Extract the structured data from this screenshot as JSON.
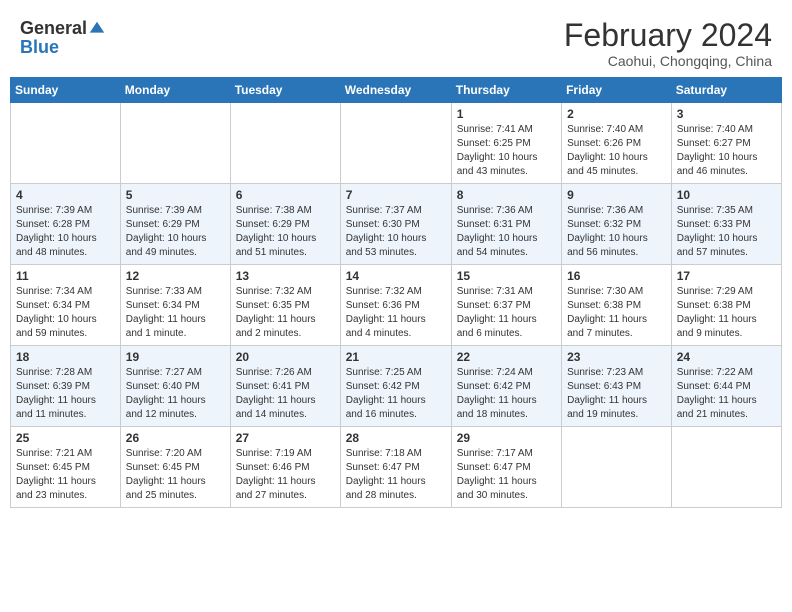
{
  "header": {
    "logo_general": "General",
    "logo_blue": "Blue",
    "month_title": "February 2024",
    "location": "Caohui, Chongqing, China"
  },
  "days_of_week": [
    "Sunday",
    "Monday",
    "Tuesday",
    "Wednesday",
    "Thursday",
    "Friday",
    "Saturday"
  ],
  "weeks": [
    [
      {
        "num": "",
        "info": ""
      },
      {
        "num": "",
        "info": ""
      },
      {
        "num": "",
        "info": ""
      },
      {
        "num": "",
        "info": ""
      },
      {
        "num": "1",
        "info": "Sunrise: 7:41 AM\nSunset: 6:25 PM\nDaylight: 10 hours\nand 43 minutes."
      },
      {
        "num": "2",
        "info": "Sunrise: 7:40 AM\nSunset: 6:26 PM\nDaylight: 10 hours\nand 45 minutes."
      },
      {
        "num": "3",
        "info": "Sunrise: 7:40 AM\nSunset: 6:27 PM\nDaylight: 10 hours\nand 46 minutes."
      }
    ],
    [
      {
        "num": "4",
        "info": "Sunrise: 7:39 AM\nSunset: 6:28 PM\nDaylight: 10 hours\nand 48 minutes."
      },
      {
        "num": "5",
        "info": "Sunrise: 7:39 AM\nSunset: 6:29 PM\nDaylight: 10 hours\nand 49 minutes."
      },
      {
        "num": "6",
        "info": "Sunrise: 7:38 AM\nSunset: 6:29 PM\nDaylight: 10 hours\nand 51 minutes."
      },
      {
        "num": "7",
        "info": "Sunrise: 7:37 AM\nSunset: 6:30 PM\nDaylight: 10 hours\nand 53 minutes."
      },
      {
        "num": "8",
        "info": "Sunrise: 7:36 AM\nSunset: 6:31 PM\nDaylight: 10 hours\nand 54 minutes."
      },
      {
        "num": "9",
        "info": "Sunrise: 7:36 AM\nSunset: 6:32 PM\nDaylight: 10 hours\nand 56 minutes."
      },
      {
        "num": "10",
        "info": "Sunrise: 7:35 AM\nSunset: 6:33 PM\nDaylight: 10 hours\nand 57 minutes."
      }
    ],
    [
      {
        "num": "11",
        "info": "Sunrise: 7:34 AM\nSunset: 6:34 PM\nDaylight: 10 hours\nand 59 minutes."
      },
      {
        "num": "12",
        "info": "Sunrise: 7:33 AM\nSunset: 6:34 PM\nDaylight: 11 hours\nand 1 minute."
      },
      {
        "num": "13",
        "info": "Sunrise: 7:32 AM\nSunset: 6:35 PM\nDaylight: 11 hours\nand 2 minutes."
      },
      {
        "num": "14",
        "info": "Sunrise: 7:32 AM\nSunset: 6:36 PM\nDaylight: 11 hours\nand 4 minutes."
      },
      {
        "num": "15",
        "info": "Sunrise: 7:31 AM\nSunset: 6:37 PM\nDaylight: 11 hours\nand 6 minutes."
      },
      {
        "num": "16",
        "info": "Sunrise: 7:30 AM\nSunset: 6:38 PM\nDaylight: 11 hours\nand 7 minutes."
      },
      {
        "num": "17",
        "info": "Sunrise: 7:29 AM\nSunset: 6:38 PM\nDaylight: 11 hours\nand 9 minutes."
      }
    ],
    [
      {
        "num": "18",
        "info": "Sunrise: 7:28 AM\nSunset: 6:39 PM\nDaylight: 11 hours\nand 11 minutes."
      },
      {
        "num": "19",
        "info": "Sunrise: 7:27 AM\nSunset: 6:40 PM\nDaylight: 11 hours\nand 12 minutes."
      },
      {
        "num": "20",
        "info": "Sunrise: 7:26 AM\nSunset: 6:41 PM\nDaylight: 11 hours\nand 14 minutes."
      },
      {
        "num": "21",
        "info": "Sunrise: 7:25 AM\nSunset: 6:42 PM\nDaylight: 11 hours\nand 16 minutes."
      },
      {
        "num": "22",
        "info": "Sunrise: 7:24 AM\nSunset: 6:42 PM\nDaylight: 11 hours\nand 18 minutes."
      },
      {
        "num": "23",
        "info": "Sunrise: 7:23 AM\nSunset: 6:43 PM\nDaylight: 11 hours\nand 19 minutes."
      },
      {
        "num": "24",
        "info": "Sunrise: 7:22 AM\nSunset: 6:44 PM\nDaylight: 11 hours\nand 21 minutes."
      }
    ],
    [
      {
        "num": "25",
        "info": "Sunrise: 7:21 AM\nSunset: 6:45 PM\nDaylight: 11 hours\nand 23 minutes."
      },
      {
        "num": "26",
        "info": "Sunrise: 7:20 AM\nSunset: 6:45 PM\nDaylight: 11 hours\nand 25 minutes."
      },
      {
        "num": "27",
        "info": "Sunrise: 7:19 AM\nSunset: 6:46 PM\nDaylight: 11 hours\nand 27 minutes."
      },
      {
        "num": "28",
        "info": "Sunrise: 7:18 AM\nSunset: 6:47 PM\nDaylight: 11 hours\nand 28 minutes."
      },
      {
        "num": "29",
        "info": "Sunrise: 7:17 AM\nSunset: 6:47 PM\nDaylight: 11 hours\nand 30 minutes."
      },
      {
        "num": "",
        "info": ""
      },
      {
        "num": "",
        "info": ""
      }
    ]
  ]
}
